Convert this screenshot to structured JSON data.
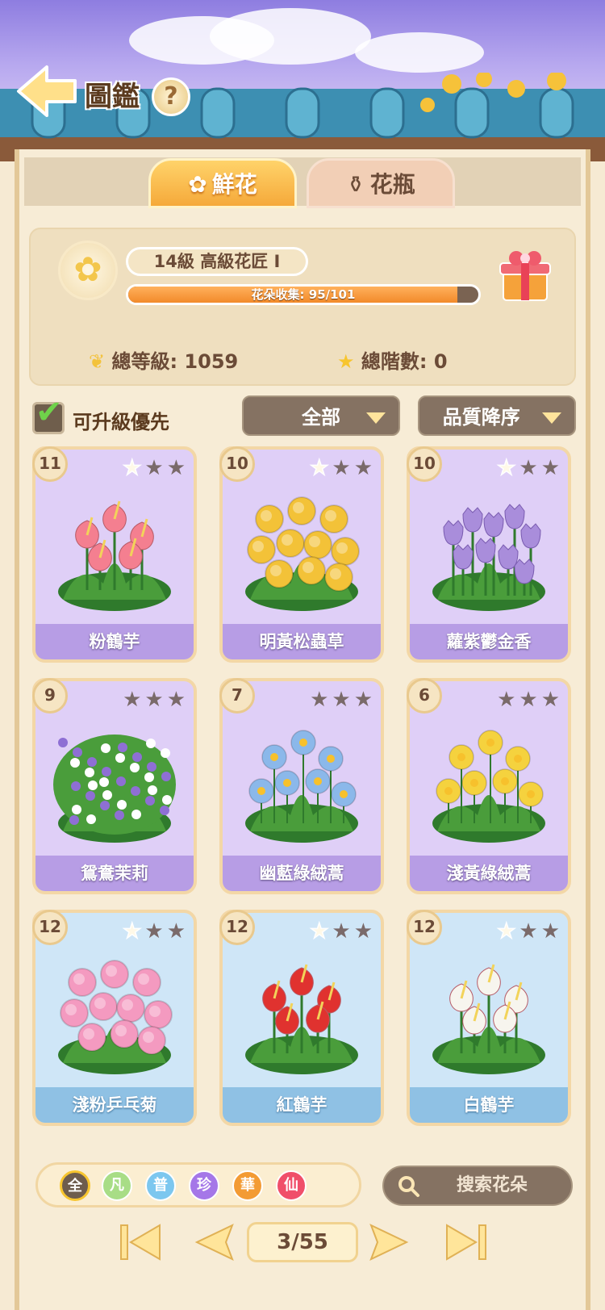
{
  "header": {
    "title": "圖鑑",
    "help_label": "?"
  },
  "tabs": [
    {
      "label": "鮮花",
      "active": true
    },
    {
      "label": "花瓶",
      "active": false
    }
  ],
  "profile": {
    "level_label": "14級  高級花匠 I",
    "collection_text": "花朵收集: 95/101",
    "collection_fraction": 0.9406,
    "total_level": "總等級: 1059",
    "total_rank": "總階數: 0"
  },
  "filter": {
    "prioritize_label": "可升級優先",
    "prioritize_checked": true,
    "category_selected": "全部",
    "sort_selected": "品質降序"
  },
  "cards": [
    {
      "level": "11",
      "name": "粉鶴芋",
      "stars": 1,
      "bg": "purple",
      "flower": "anthurium",
      "color": "#f47f90"
    },
    {
      "level": "10",
      "name": "明黃松蟲草",
      "stars": 1,
      "bg": "purple",
      "flower": "pompom",
      "color": "#f3c238"
    },
    {
      "level": "10",
      "name": "蘿紫鬱金香",
      "stars": 1,
      "bg": "purple",
      "flower": "tulip",
      "color": "#a98ddb"
    },
    {
      "level": "9",
      "name": "鴛鴦茉莉",
      "stars": 0,
      "bg": "purple",
      "flower": "bush",
      "color": "#8e6fd4"
    },
    {
      "level": "7",
      "name": "幽藍綠絨蒿",
      "stars": 0,
      "bg": "purple",
      "flower": "poppy",
      "color": "#8bb8ea"
    },
    {
      "level": "6",
      "name": "淺黃綠絨蒿",
      "stars": 0,
      "bg": "purple",
      "flower": "poppy",
      "color": "#f5d23e"
    },
    {
      "level": "12",
      "name": "淺粉乒乓菊",
      "stars": 1,
      "bg": "blue",
      "flower": "pompom",
      "color": "#f49ac0"
    },
    {
      "level": "12",
      "name": "紅鶴芋",
      "stars": 1,
      "bg": "blue",
      "flower": "anthurium",
      "color": "#e0322f"
    },
    {
      "level": "12",
      "name": "白鶴芋",
      "stars": 1,
      "bg": "blue",
      "flower": "anthurium",
      "color": "#f7f5ee"
    }
  ],
  "quality_filters": [
    {
      "label": "全",
      "color": "#6e5d4d",
      "selected": true
    },
    {
      "label": "凡",
      "color": "#a8dd86",
      "selected": false
    },
    {
      "label": "普",
      "color": "#7cc7ef",
      "selected": false
    },
    {
      "label": "珍",
      "color": "#a577e8",
      "selected": false
    },
    {
      "label": "華",
      "color": "#f39b34",
      "selected": false
    },
    {
      "label": "仙",
      "color": "#f04f6a",
      "selected": false
    }
  ],
  "search": {
    "placeholder": "搜索花朵",
    "icon": "magnifier-icon"
  },
  "pager": {
    "indicator": "3/55"
  }
}
